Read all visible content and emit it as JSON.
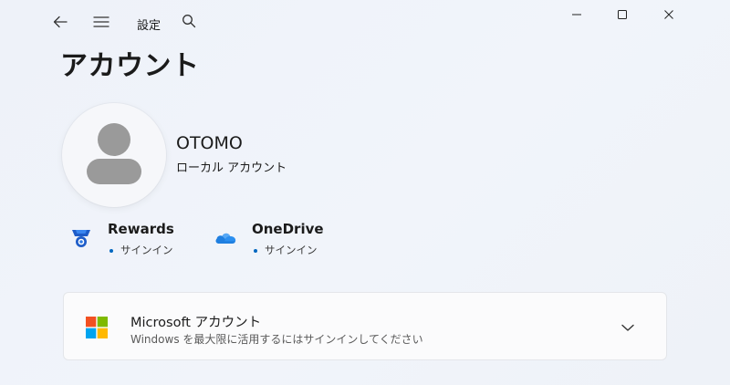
{
  "titlebar": {
    "app_title": "設定",
    "back_icon": "back-arrow-icon",
    "menu_icon": "hamburger-menu-icon",
    "search_icon": "search-icon",
    "window_controls": [
      "minimize-icon",
      "maximize-icon",
      "close-icon"
    ]
  },
  "page": {
    "title": "アカウント"
  },
  "user": {
    "name": "OTOMO",
    "account_type": "ローカル アカウント",
    "avatar_icon": "default-user-avatar-icon"
  },
  "services": [
    {
      "name": "Rewards",
      "status": "サインイン",
      "icon": "rewards-medal-icon"
    },
    {
      "name": "OneDrive",
      "status": "サインイン",
      "icon": "onedrive-cloud-icon"
    }
  ],
  "microsoft_account": {
    "title": "Microsoft アカウント",
    "description": "Windows を最大限に活用するにはサインインしてください",
    "icon": "microsoft-logo-icon",
    "expand_icon": "chevron-down-icon"
  },
  "colors": {
    "accent": "#0067c0",
    "ms_red": "#f25022",
    "ms_green": "#7fba00",
    "ms_blue": "#00a4ef",
    "ms_yellow": "#ffb900"
  }
}
